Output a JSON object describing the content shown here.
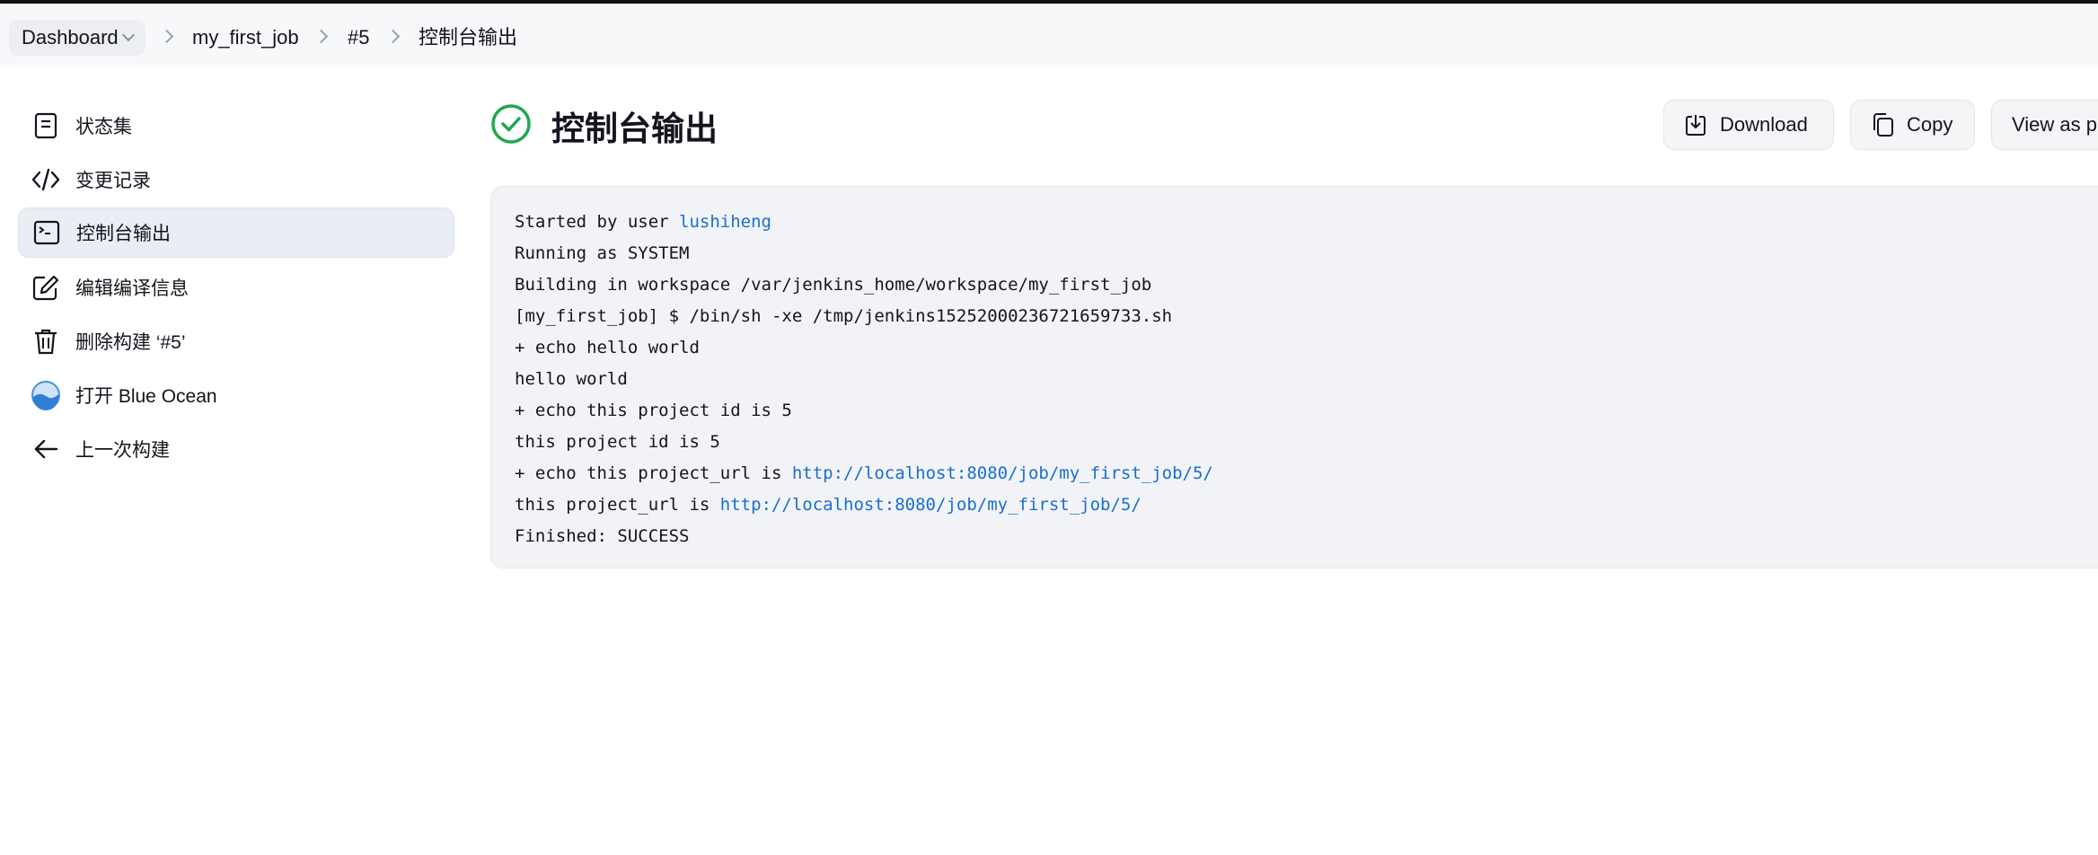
{
  "breadcrumb": {
    "items": [
      {
        "label": "Dashboard"
      },
      {
        "label": "my_first_job"
      },
      {
        "label": "#5"
      },
      {
        "label": "控制台输出"
      }
    ]
  },
  "sidebar": {
    "items": [
      {
        "label": "状态集",
        "icon": "document-icon"
      },
      {
        "label": "变更记录",
        "icon": "code-icon"
      },
      {
        "label": "控制台输出",
        "icon": "terminal-icon",
        "active": true
      },
      {
        "label": "编辑编译信息",
        "icon": "edit-icon"
      },
      {
        "label": "删除构建 ‘#5’",
        "icon": "trash-icon"
      },
      {
        "label": "打开 Blue Ocean",
        "icon": "blue-ocean-icon"
      },
      {
        "label": "上一次构建",
        "icon": "arrow-left-icon"
      }
    ]
  },
  "main": {
    "title": "控制台输出",
    "status_icon": "success-check-icon",
    "actions": {
      "download": "Download",
      "copy": "Copy",
      "view_plain": "View as p"
    }
  },
  "console": {
    "lines": [
      {
        "text": "Started by user ",
        "link": "lushiheng"
      },
      {
        "text": "Running as SYSTEM"
      },
      {
        "text": "Building in workspace /var/jenkins_home/workspace/my_first_job"
      },
      {
        "text": "[my_first_job] $ /bin/sh -xe /tmp/jenkins15252000236721659733.sh"
      },
      {
        "text": "+ echo hello world"
      },
      {
        "text": "hello world"
      },
      {
        "text": "+ echo this project id is 5"
      },
      {
        "text": "this project id is 5"
      },
      {
        "text": "+ echo this project_url is ",
        "link": "http://localhost:8080/job/my_first_job/5/"
      },
      {
        "text": "this project_url is ",
        "link": "http://localhost:8080/job/my_first_job/5/"
      },
      {
        "text": "Finished: SUCCESS"
      }
    ]
  },
  "colors": {
    "success": "#1fa84f",
    "link": "#1a6dd6",
    "active_bg": "#e9edf4"
  }
}
